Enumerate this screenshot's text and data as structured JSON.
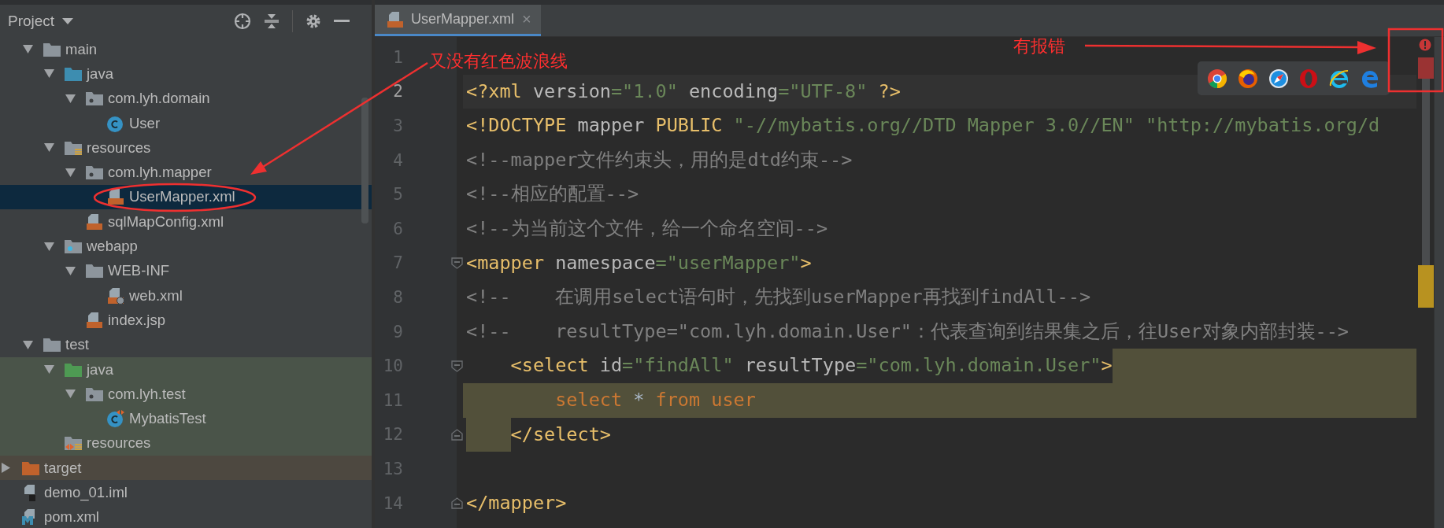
{
  "project_panel": {
    "title": "Project",
    "tree": {
      "src_children": [
        {
          "kind": "folder",
          "label": "main",
          "expanded": true,
          "selected": false,
          "test_scope": false,
          "excluded": false,
          "children": [
            {
              "kind": "source-folder",
              "label": "java",
              "expanded": true,
              "selected": false,
              "test_scope": false,
              "excluded": false,
              "children": [
                {
                  "kind": "package",
                  "label": "com.lyh.domain",
                  "expanded": true,
                  "selected": false,
                  "test_scope": false,
                  "excluded": false,
                  "children": [
                    {
                      "kind": "class",
                      "label": "User",
                      "selected": false,
                      "test_scope": false,
                      "excluded": false
                    }
                  ]
                }
              ]
            },
            {
              "kind": "resources-folder",
              "label": "resources",
              "expanded": true,
              "selected": false,
              "test_scope": false,
              "excluded": false,
              "children": [
                {
                  "kind": "package",
                  "label": "com.lyh.mapper",
                  "expanded": true,
                  "selected": false,
                  "test_scope": false,
                  "excluded": false,
                  "children": [
                    {
                      "kind": "xml",
                      "label": "UserMapper.xml",
                      "selected": true,
                      "test_scope": false,
                      "excluded": false
                    }
                  ]
                },
                {
                  "kind": "xml",
                  "label": "sqlMapConfig.xml",
                  "selected": false,
                  "test_scope": false,
                  "excluded": false
                }
              ]
            },
            {
              "kind": "web-folder",
              "label": "webapp",
              "expanded": true,
              "selected": false,
              "test_scope": false,
              "excluded": false,
              "children": [
                {
                  "kind": "folder",
                  "label": "WEB-INF",
                  "expanded": true,
                  "selected": false,
                  "test_scope": false,
                  "excluded": false,
                  "children": [
                    {
                      "kind": "web-xml",
                      "label": "web.xml",
                      "selected": false,
                      "test_scope": false,
                      "excluded": false
                    }
                  ]
                },
                {
                  "kind": "jsp",
                  "label": "index.jsp",
                  "selected": false,
                  "test_scope": false,
                  "excluded": false
                }
              ]
            }
          ]
        },
        {
          "kind": "folder",
          "label": "test",
          "expanded": true,
          "selected": false,
          "test_scope": false,
          "excluded": false,
          "children": [
            {
              "kind": "test-folder",
              "label": "java",
              "expanded": true,
              "selected": false,
              "test_scope": true,
              "excluded": false,
              "children": [
                {
                  "kind": "package",
                  "label": "com.lyh.test",
                  "expanded": true,
                  "selected": false,
                  "test_scope": true,
                  "excluded": false,
                  "children": [
                    {
                      "kind": "test-class",
                      "label": "MybatisTest",
                      "selected": false,
                      "test_scope": true,
                      "excluded": false
                    }
                  ]
                }
              ]
            },
            {
              "kind": "test-resources",
              "label": "resources",
              "selected": false,
              "test_scope": true,
              "excluded": false
            }
          ]
        }
      ],
      "root_items": [
        {
          "kind": "excluded-folder",
          "label": "target",
          "expanded": false,
          "selected": false,
          "test_scope": false,
          "excluded": true
        },
        {
          "kind": "iml",
          "label": "demo_01.iml",
          "selected": false,
          "test_scope": false,
          "excluded": false
        },
        {
          "kind": "maven",
          "label": "pom.xml",
          "selected": false,
          "test_scope": false,
          "excluded": false
        }
      ]
    }
  },
  "editor": {
    "tabs": [
      {
        "label": "UserMapper.xml",
        "close": "×",
        "selected": true
      }
    ],
    "lines": [
      {
        "number": "1",
        "current": false
      },
      {
        "number": "2",
        "current": true,
        "tokens": [
          {
            "kind": "tag",
            "text": "<?xml"
          },
          {
            "kind": "attr",
            "text": " version"
          },
          {
            "kind": "string",
            "text": "=\"1.0\""
          },
          {
            "kind": "attr",
            "text": " encoding"
          },
          {
            "kind": "string",
            "text": "=\"UTF-8\""
          },
          {
            "kind": "tag",
            "text": " ?>"
          }
        ]
      },
      {
        "number": "3",
        "current": false,
        "tokens": [
          {
            "kind": "tag",
            "text": "<!DOCTYPE"
          },
          {
            "kind": "attr",
            "text": " mapper"
          },
          {
            "kind": "tag",
            "text": " PUBLIC"
          },
          {
            "kind": "string",
            "text": " \"-//mybatis.org//DTD Mapper 3.0//EN\" \"http://mybatis.org/d"
          }
        ]
      },
      {
        "number": "4",
        "current": false,
        "tokens": [
          {
            "kind": "comment",
            "text": "<!--mapper文件约束头，用的是dtd约束-->"
          }
        ]
      },
      {
        "number": "5",
        "current": false,
        "tokens": [
          {
            "kind": "comment",
            "text": "<!--相应的配置-->"
          }
        ]
      },
      {
        "number": "6",
        "current": false,
        "tokens": [
          {
            "kind": "comment",
            "text": "<!--为当前这个文件，给一个命名空间-->"
          }
        ]
      },
      {
        "number": "7",
        "current": false,
        "fold_marker": true,
        "fold_end": false,
        "tokens": [
          {
            "kind": "tag",
            "text": "<mapper"
          },
          {
            "kind": "attr",
            "text": " namespace"
          },
          {
            "kind": "string",
            "text": "=\"userMapper\""
          },
          {
            "kind": "tag",
            "text": ">"
          }
        ]
      },
      {
        "number": "8",
        "current": false,
        "tokens": [
          {
            "kind": "comment",
            "text": "<!--    在调用select语句时，先找到userMapper再找到findAll-->"
          }
        ]
      },
      {
        "number": "9",
        "current": false,
        "tokens": [
          {
            "kind": "comment",
            "text": "<!--    resultType=\"com.lyh.domain.User\"：代表查询到结果集之后，往User对象内部封装-->"
          }
        ]
      },
      {
        "number": "10",
        "current": false,
        "injected": true,
        "fold_marker": true,
        "fold_end": false,
        "tokens": [
          {
            "kind": "tag",
            "text": "    <select"
          },
          {
            "kind": "attr",
            "text": " id"
          },
          {
            "kind": "string",
            "text": "=\"findAll\""
          },
          {
            "kind": "attr",
            "text": " resultType"
          },
          {
            "kind": "string",
            "text": "=\"com.lyh.domain.User\""
          },
          {
            "kind": "tag",
            "text": ">"
          }
        ]
      },
      {
        "number": "11",
        "current": false,
        "injected": true,
        "tokens": [
          {
            "kind": "keyword",
            "text": "        select"
          },
          {
            "kind": "plain",
            "text": " * "
          },
          {
            "kind": "keyword",
            "text": "from user"
          }
        ]
      },
      {
        "number": "12",
        "current": false,
        "injected": true,
        "fold_marker": true,
        "fold_end": true,
        "tokens": [
          {
            "kind": "tag",
            "text": "    </select>"
          }
        ]
      },
      {
        "number": "13",
        "current": false
      },
      {
        "number": "14",
        "current": false,
        "fold_marker": true,
        "fold_end": true,
        "tokens": [
          {
            "kind": "tag",
            "text": "</mapper>"
          }
        ]
      }
    ]
  },
  "annotations": [
    {
      "text": "又没有红色波浪线"
    },
    {
      "text": "有报错"
    }
  ]
}
